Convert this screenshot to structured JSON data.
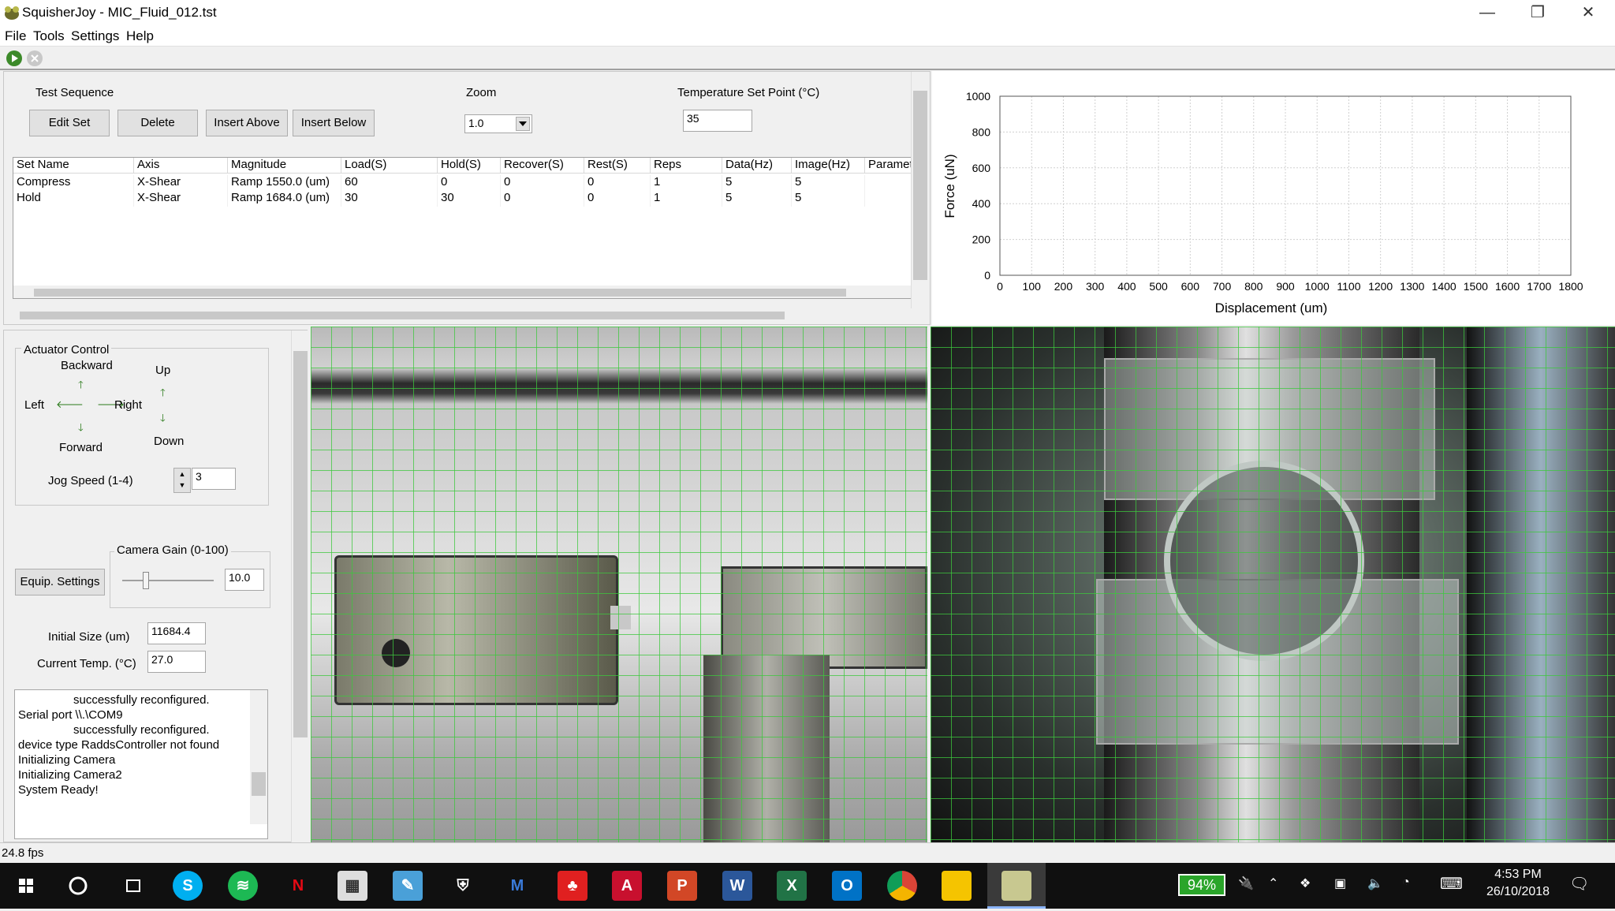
{
  "window": {
    "title": "SquisherJoy - MIC_Fluid_012.tst",
    "minimize": "—",
    "restore": "❐",
    "close": "✕"
  },
  "menu": [
    "File",
    "Tools",
    "Settings",
    "Help"
  ],
  "sequence": {
    "label": "Test Sequence",
    "buttons": [
      "Edit Set",
      "Delete",
      "Insert Above",
      "Insert Below"
    ],
    "zoom_label": "Zoom",
    "zoom_value": "1.0",
    "temp_label": "Temperature Set Point (°C)",
    "temp_value": "35",
    "columns": [
      "Set Name",
      "Axis",
      "Magnitude",
      "Load(S)",
      "Hold(S)",
      "Recover(S)",
      "Rest(S)",
      "Reps",
      "Data(Hz)",
      "Image(Hz)",
      "Paramet"
    ],
    "rows": [
      [
        "Compress",
        "X-Shear",
        "Ramp 1550.0 (um)",
        "60",
        "0",
        "0",
        "0",
        "1",
        "5",
        "5",
        ""
      ],
      [
        "Hold",
        "X-Shear",
        "Ramp 1684.0 (um)",
        "30",
        "30",
        "0",
        "0",
        "1",
        "5",
        "5",
        ""
      ]
    ]
  },
  "chart_data": {
    "type": "scatter",
    "title": "",
    "xlabel": "Displacement (um)",
    "ylabel": "Force (uN)",
    "xlim": [
      0,
      1800
    ],
    "ylim": [
      0,
      1000
    ],
    "xticks": [
      "0",
      "100",
      "200",
      "300",
      "400",
      "500",
      "600",
      "700",
      "800",
      "900",
      "1000",
      "1100",
      "1200",
      "1300",
      "1400",
      "1500",
      "1600",
      "1700",
      "1800"
    ],
    "yticks": [
      "0",
      "200",
      "400",
      "600",
      "800",
      "1000"
    ],
    "grid": true,
    "series": []
  },
  "actuator": {
    "group_label": "Actuator Control",
    "backward": "Backward",
    "forward": "Forward",
    "left": "Left",
    "right": "Right",
    "up": "Up",
    "down": "Down",
    "jog_label": "Jog Speed (1-4)",
    "jog_value": "3"
  },
  "camera": {
    "gain_label": "Camera Gain (0-100)",
    "gain_value": "10.0",
    "equip_button": "Equip. Settings"
  },
  "fields": {
    "initial_size_label": "Initial Size (um)",
    "initial_size_value": "11684.4",
    "current_temp_label": "Current Temp. (°C)",
    "current_temp_value": "27.0"
  },
  "log": [
    "successfully reconfigured.",
    "Serial port \\\\.\\COM9",
    "successfully reconfigured.",
    "device type RaddsController not found",
    "Initializing Camera",
    "Initializing Camera2",
    "System Ready!"
  ],
  "status": {
    "fps": "24.8 fps"
  },
  "taskbar": {
    "battery": "94%",
    "time": "4:53 PM",
    "date": "26/10/2018",
    "apps": [
      "windows-start",
      "cortana",
      "task-view",
      "skype",
      "spotify",
      "netflix",
      "calculator",
      "paint",
      "defender",
      "malwarebytes",
      "canada-app",
      "acrobat",
      "powerpoint",
      "word",
      "excel",
      "outlook",
      "chrome",
      "file-explorer",
      "squisherjoy"
    ]
  }
}
